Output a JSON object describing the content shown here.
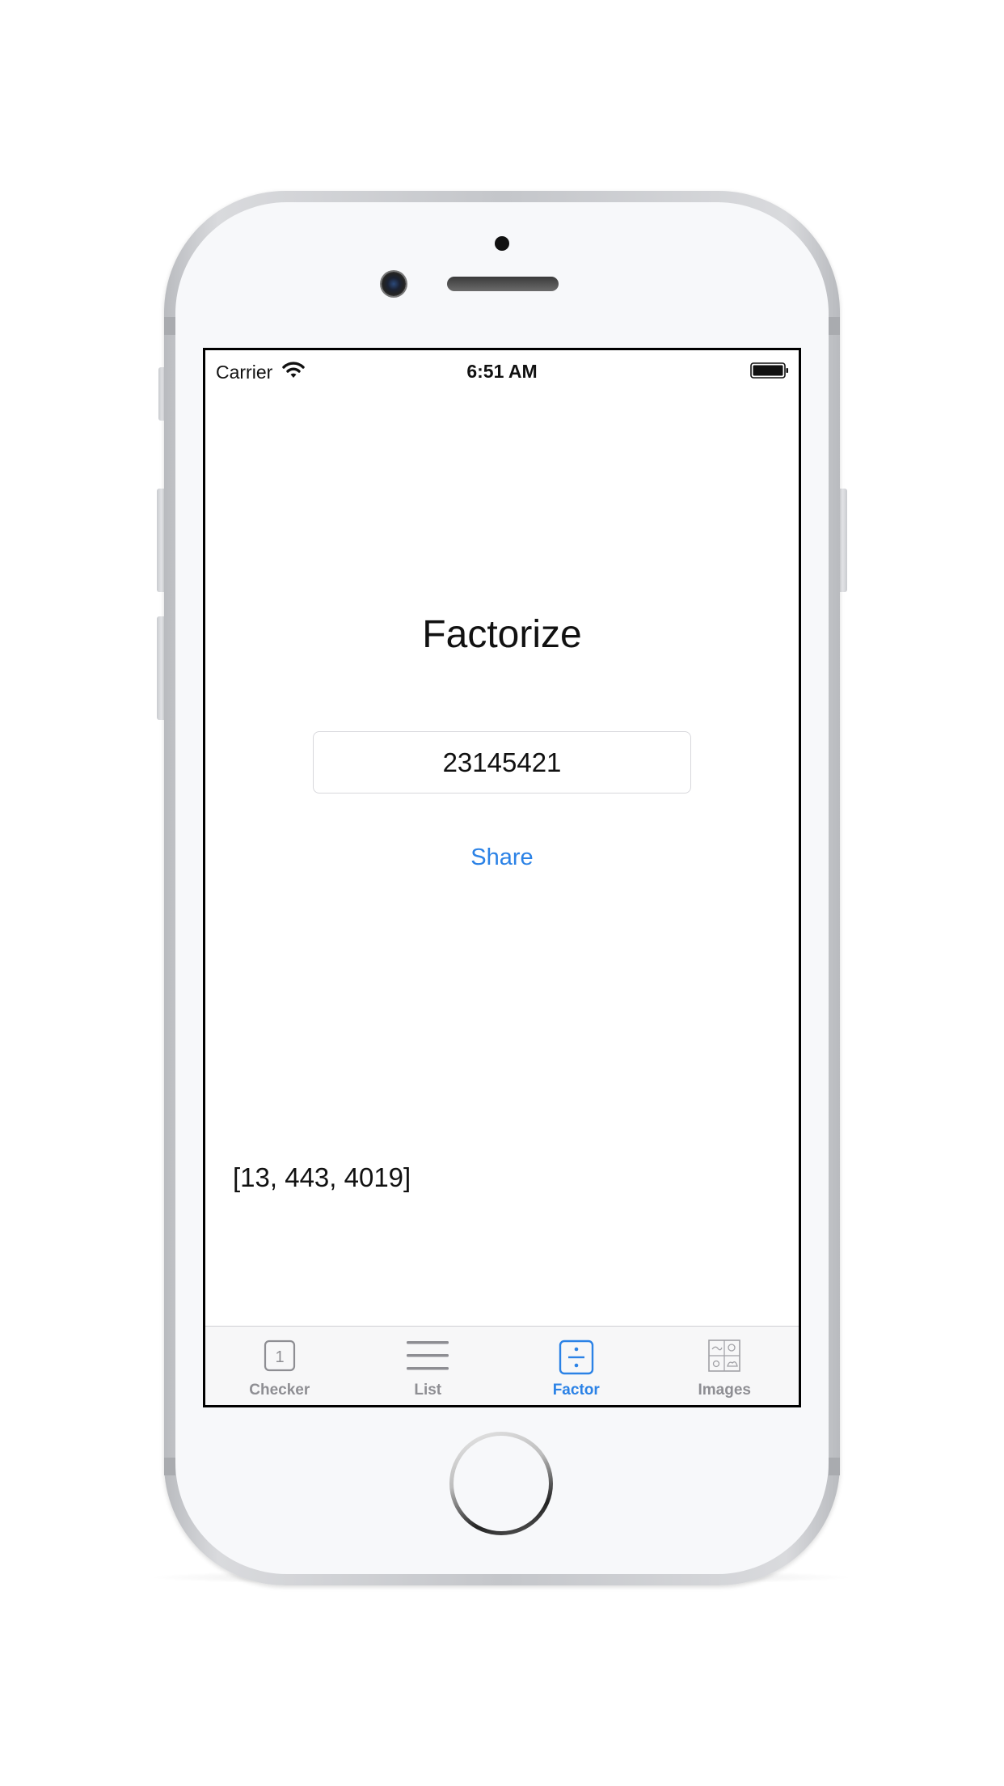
{
  "status_bar": {
    "carrier": "Carrier",
    "time": "6:51 AM"
  },
  "main": {
    "title": "Factorize",
    "number_input": {
      "value": "23145421"
    },
    "share_label": "Share",
    "result": "[13, 443, 4019]"
  },
  "tab_bar": {
    "active_tab": "Factor",
    "tabs": [
      {
        "label": "Checker",
        "icon": "checker-icon"
      },
      {
        "label": "List",
        "icon": "list-icon"
      },
      {
        "label": "Factor",
        "icon": "factor-icon"
      },
      {
        "label": "Images",
        "icon": "images-icon"
      }
    ]
  },
  "colors": {
    "accent": "#2b82e6",
    "tab_inactive": "#8e8e93",
    "text": "#111111"
  }
}
